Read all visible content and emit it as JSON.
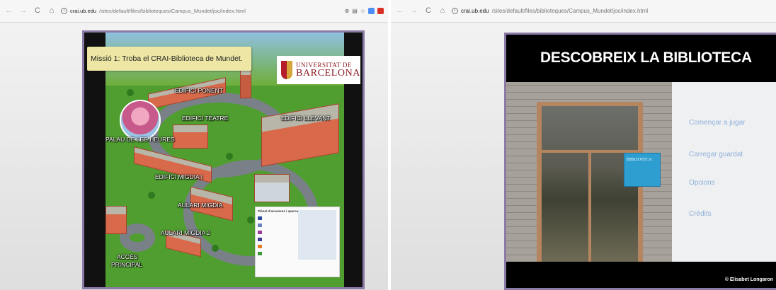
{
  "left_window": {
    "address": {
      "host": "crai.ub.edu",
      "path": "/sites/default/files/biblioteques/Campus_Mundet/joc/index.html"
    },
    "game": {
      "mission_text": "Missió 1: Troba el CRAI-Biblioteca de Mundet.",
      "logo": {
        "line1": "UNIVERSITAT DE",
        "line2": "BARCELONA"
      },
      "map_labels": {
        "ponent": "EDIFICI PONENT",
        "teatre": "EDIFICI TEATRE",
        "llevant": "EDIFICI LLEVANT",
        "palau": "PALAU DE LES HEURES",
        "migdia1": "EDIFICI MIGDIA I",
        "aulari_migdia": "AULARI MIGDIA",
        "aulari_migdia2": "AULARI MIGDIA 2",
        "acces": "ACCÈS",
        "principal": "PRINCIPAL"
      },
      "legend": {
        "title": "Plànol d'accessos i aparcaments",
        "items": [
          {
            "color": "#2a4aa0"
          },
          {
            "color": "#6a7fbf"
          },
          {
            "color": "#9b3a9c"
          },
          {
            "color": "#3b3b8f"
          },
          {
            "color": "#e07b2a"
          },
          {
            "color": "#3a9a3a"
          }
        ]
      }
    }
  },
  "right_window": {
    "address": {
      "host": "crai.ub.edu",
      "path": "/sites/default/files/biblioteques/Campus_Mundet/joc/index.html"
    },
    "game": {
      "title": "DESCOBREIX LA BIBLIOTECA",
      "sign_text": "BIBLIOTECA",
      "menu": [
        {
          "label": "Començar a jugar"
        },
        {
          "label": "Carregar guardat"
        },
        {
          "label": "Opcions"
        },
        {
          "label": "Crèdits"
        }
      ],
      "copyright": "© Elisabet Longaron"
    }
  },
  "colors": {
    "frame_border": "#8c7aa6",
    "mission_bg": "#ede6a4",
    "menu_text": "#8fb1da",
    "ub_red": "#8a1a22"
  },
  "icons": [
    "back-icon",
    "forward-icon",
    "reload-icon",
    "home-icon",
    "info-icon",
    "zoom-icon",
    "translate-icon",
    "bookmark-star-icon",
    "extension-icon"
  ]
}
